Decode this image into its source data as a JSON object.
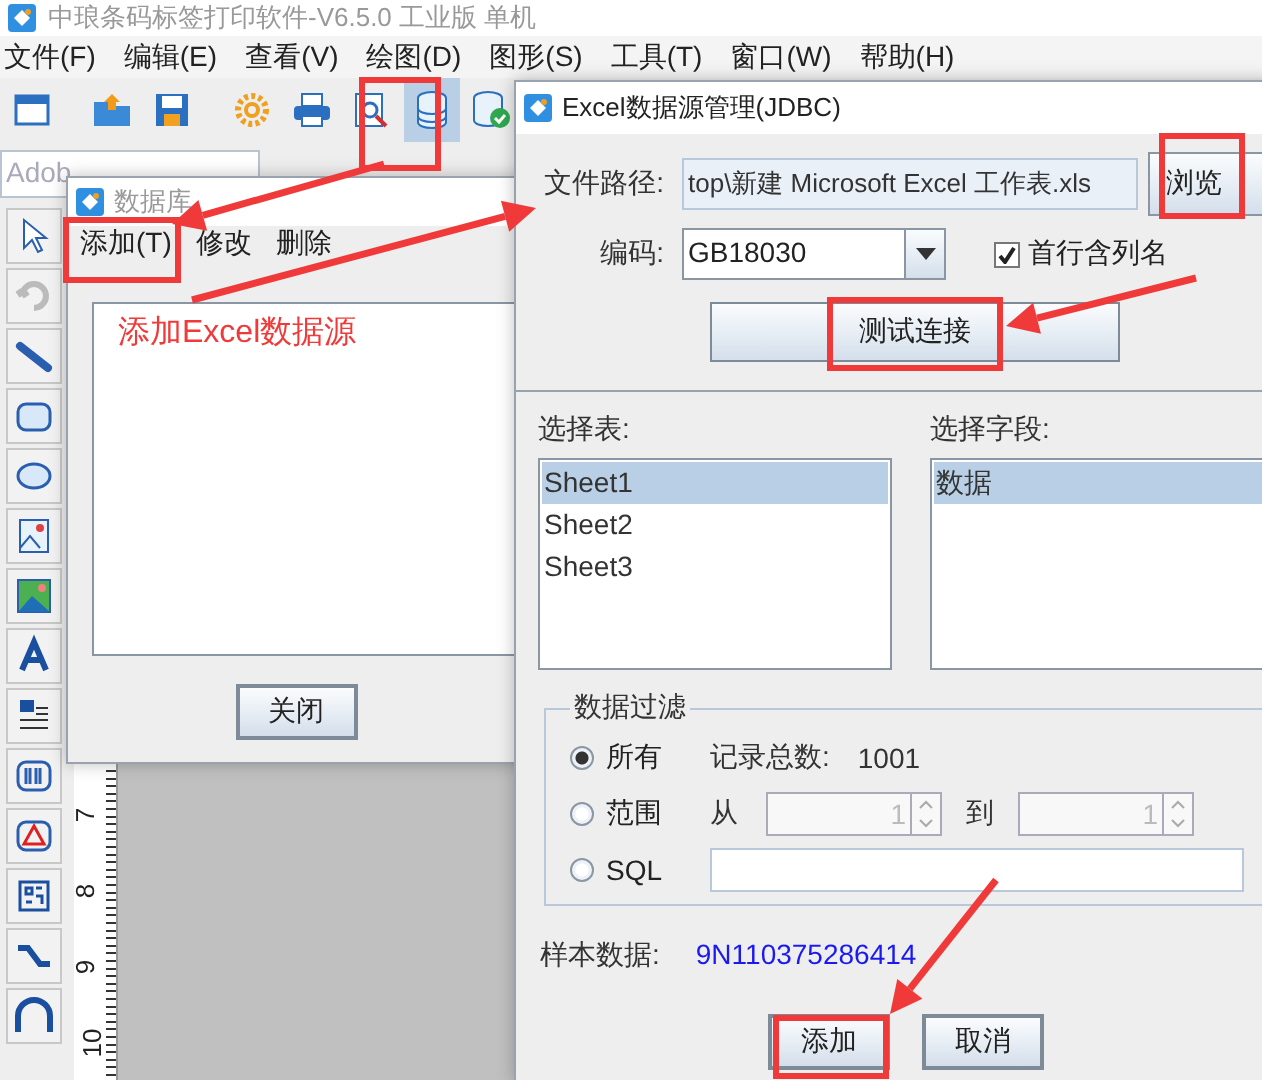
{
  "app": {
    "title": "中琅条码标签打印软件-V6.5.0 工业版 单机",
    "menu": [
      "文件(F)",
      "编辑(E)",
      "查看(V)",
      "绘图(D)",
      "图形(S)",
      "工具(T)",
      "窗口(W)",
      "帮助(H)"
    ],
    "toolbar": [
      {
        "selected": false
      },
      {
        "selected": false
      },
      {
        "selected": false
      },
      {
        "selected": false
      },
      {
        "selected": false
      },
      {
        "selected": false
      },
      {
        "selected": true
      },
      {
        "selected": false
      }
    ],
    "font_field": "Adob",
    "ruler_labels": [
      "7",
      "8",
      "9",
      "10"
    ]
  },
  "db_dialog": {
    "title": "数据库",
    "menu": [
      "添加(T)",
      "修改",
      "删除"
    ],
    "annotation": "添加Excel数据源",
    "close_button": "关闭"
  },
  "excel_dialog": {
    "title": "Excel数据源管理(JDBC)",
    "file_path_label": "文件路径:",
    "file_path": "top\\新建 Microsoft Excel 工作表.xls",
    "browse_button": "浏览",
    "encoding_label": "编码:",
    "encoding": "GB18030",
    "header_row": {
      "label": "首行含列名",
      "checked": true
    },
    "test_button": "测试连接",
    "tables_label": "选择表:",
    "tables": [
      {
        "label": "Sheet1",
        "selected": true
      },
      {
        "label": "Sheet2",
        "selected": false
      },
      {
        "label": "Sheet3",
        "selected": false
      }
    ],
    "fields_label": "选择字段:",
    "fields": [
      {
        "label": "数据",
        "selected": true
      }
    ],
    "filter": {
      "title": "数据过滤",
      "options": [
        {
          "kind": "all",
          "label": "所有",
          "selected": true
        },
        {
          "kind": "range",
          "label": "范围",
          "selected": false
        },
        {
          "kind": "sql",
          "label": "SQL",
          "selected": false
        }
      ],
      "record_count_label": "记录总数:",
      "record_count": "1001",
      "from_label": "从",
      "from": "1",
      "to_label": "到",
      "to": "1"
    },
    "sample_label": "样本数据:",
    "sample": "9N110375286414",
    "buttons": [
      "添加",
      "取消"
    ]
  }
}
